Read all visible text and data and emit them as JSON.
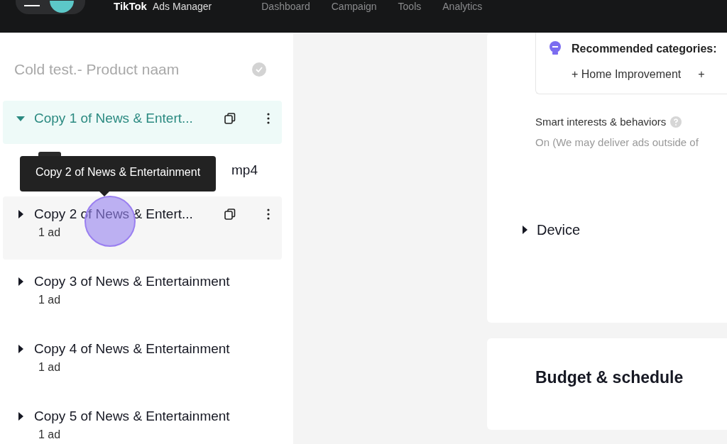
{
  "header": {
    "logo": "TikTok",
    "product": "Ads Manager",
    "nav": [
      {
        "label": "Dashboard",
        "selected": false
      },
      {
        "label": "Campaign",
        "selected": false
      },
      {
        "label": "Tools",
        "selected": false
      },
      {
        "label": "Analytics",
        "selected": false
      }
    ]
  },
  "sidebar": {
    "campaign": "Cold test.- Product naam",
    "groups": [
      {
        "name": "Copy 1 of News & Entert...",
        "expanded": true,
        "selected": true,
        "hovered": false,
        "children": [
          {
            "name": "mp4"
          }
        ]
      },
      {
        "name": "Copy 2 of News & Entert...",
        "count": "1 ad",
        "expanded": false,
        "selected": false,
        "hovered": true
      },
      {
        "name": "Copy 3 of News & Entertainment",
        "count": "1 ad",
        "expanded": false,
        "selected": false,
        "hovered": false
      },
      {
        "name": "Copy 4 of News & Entertainment",
        "count": "1 ad",
        "expanded": false,
        "selected": false,
        "hovered": false
      },
      {
        "name": "Copy 5 of News & Entertainment",
        "count": "1 ad",
        "expanded": false,
        "selected": false,
        "hovered": false
      }
    ],
    "tooltip": "Copy 2 of News & Entertainment"
  },
  "targeting": {
    "recommended_label": "Recommended categories:",
    "categories": [
      "+ Home Improvement",
      "+"
    ],
    "smart_label": "Smart interests & behaviors",
    "smart_value": "On (We may deliver ads outside of",
    "sections": [
      {
        "label": "Device",
        "expanded": false
      }
    ]
  },
  "budget": {
    "title": "Budget & schedule"
  }
}
